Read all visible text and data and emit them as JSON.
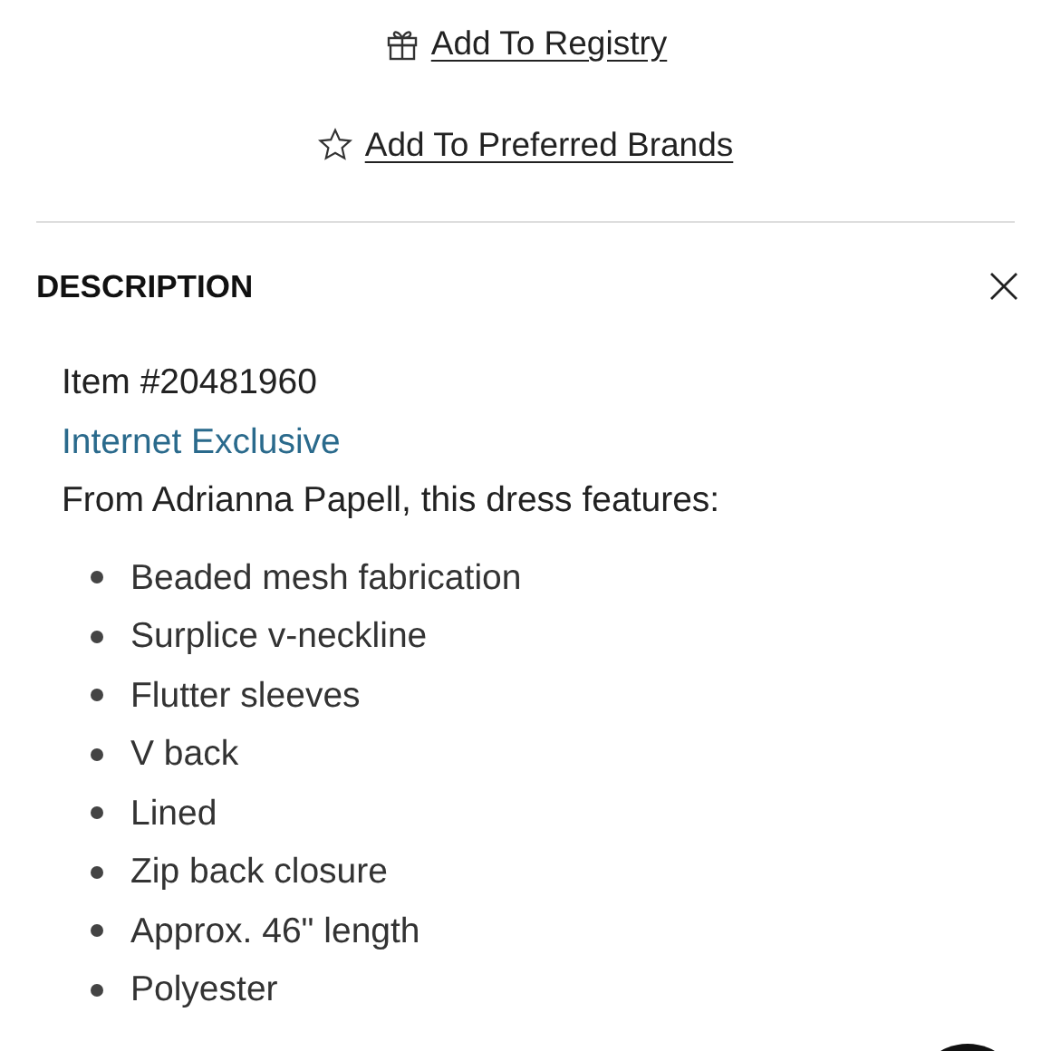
{
  "actions": [
    {
      "kind": "registry",
      "label": "Add To Registry"
    },
    {
      "kind": "brands",
      "label": "Add To Preferred Brands"
    }
  ],
  "description": {
    "title": "DESCRIPTION",
    "expanded": true,
    "item_number": "Item #20481960",
    "badge": "Internet Exclusive",
    "intro": "From Adrianna Papell, this dress features:",
    "features": [
      "Beaded mesh fabrication",
      "Surplice v-neckline",
      "Flutter sleeves",
      "V back",
      "Lined",
      "Zip back closure",
      "Approx. 46\" length",
      "Polyester"
    ]
  }
}
